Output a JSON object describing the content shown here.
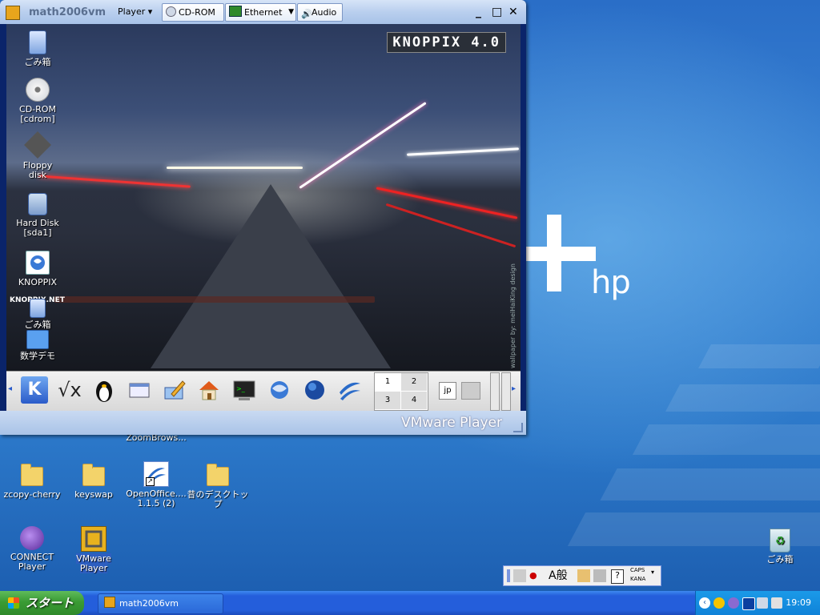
{
  "host_desktop": {
    "brand_text": "hp",
    "icons": [
      {
        "name": "icon-zoombrowser",
        "label": "ZoomBrows..."
      },
      {
        "name": "icon-zcopy-cherry",
        "label": "zcopy-cherry"
      },
      {
        "name": "icon-keyswap",
        "label": "keyswap"
      },
      {
        "name": "icon-openoffice",
        "label1": "OpenOffice....",
        "label2": "1.1.5 (2)"
      },
      {
        "name": "icon-old-desktop",
        "label": "昔のデスクトップ"
      },
      {
        "name": "icon-connect-player",
        "label1": "CONNECT",
        "label2": "Player"
      },
      {
        "name": "icon-vmware-player",
        "label1": "VMware",
        "label2": "Player"
      },
      {
        "name": "icon-recycle-bin",
        "label": "ごみ箱"
      }
    ]
  },
  "vm_window": {
    "title": "math2006vm",
    "menu_player": "Player",
    "devices": {
      "cdrom": "CD-ROM",
      "ethernet": "Ethernet",
      "audio": "Audio"
    },
    "controls": {
      "minimize": "_",
      "maximize": "□",
      "close": "✕"
    },
    "footer_brand": "VMware Player"
  },
  "guest": {
    "logo": "KNOPPIX 4.0",
    "photo_credit": "wallpaper by: meiHaiKing design",
    "icons": [
      {
        "label1": "ごみ箱",
        "label2": ""
      },
      {
        "label1": "CD-ROM",
        "label2": "[cdrom]"
      },
      {
        "label1": "Floppy",
        "label2": "disk"
      },
      {
        "label1": "Hard Disk",
        "label2": "[sda1]"
      },
      {
        "label1": "KNOPPIX",
        "label2": ""
      },
      {
        "label1": "ごみ箱",
        "label2": ""
      },
      {
        "label1": "数学デモ",
        "label2": ""
      }
    ],
    "knoppix_net": "KNOPPIX.NET",
    "panel": {
      "pager": [
        "1",
        "2",
        "3",
        "4"
      ],
      "apps": [
        "kde-menu",
        "sqrt-x",
        "tux",
        "window-list",
        "kate",
        "home",
        "terminal",
        "konqueror",
        "mozilla",
        "openoffice"
      ]
    }
  },
  "language_bar": {
    "ime": "A般",
    "caps": "CAPS",
    "kana": "KANA",
    "help": "?"
  },
  "taskbar": {
    "start": "スタート",
    "task": "math2006vm",
    "clock": "19:09"
  },
  "colors": {
    "taskbar": "#245edb",
    "start": "#3a9b34",
    "tray": "#0f82d8"
  }
}
